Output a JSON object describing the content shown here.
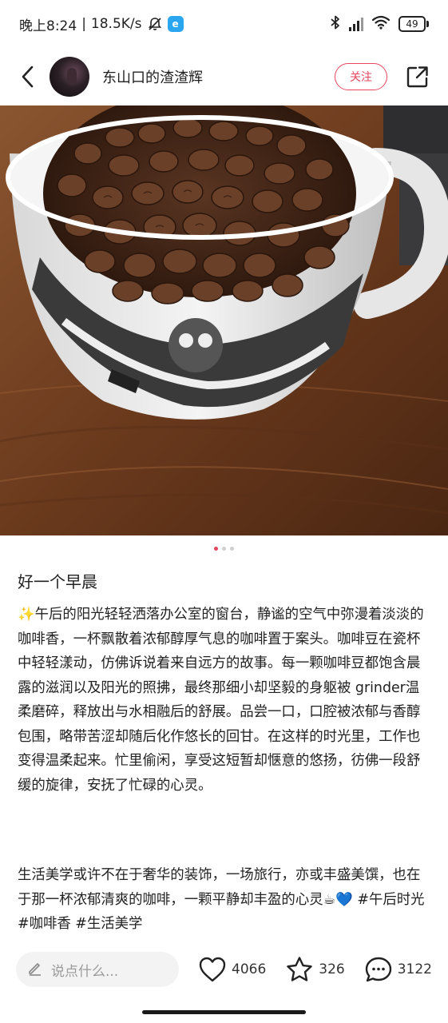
{
  "status_bar": {
    "time": "晚上8:24",
    "separator": "|",
    "network_speed": "18.5K/s",
    "battery": "49",
    "app_badge": "e"
  },
  "header": {
    "username": "东山口的渣渣辉",
    "follow_label": "关注"
  },
  "carousel": {
    "total": 3,
    "active_index": 0
  },
  "post": {
    "title": "好一个早晨",
    "paragraph_1": "✨午后的阳光轻轻洒落办公室的窗台，静谧的空气中弥漫着淡淡的咖啡香，一杯飘散着浓郁醇厚气息的咖啡置于案头。咖啡豆在瓷杯中轻轻漾动，仿佛诉说着来自远方的故事。每一颗咖啡豆都饱含晨露的滋润以及阳光的照拂，最终那细小却坚毅的身躯被 grinder温柔磨碎，释放出与水相融后的舒展。品尝一口，口腔被浓郁与香醇包围，略带苦涩却随后化作悠长的回甘。在这样的时光里，工作也变得温柔起来。忙里偷闲，享受这短暂却惬意的悠扬，彷佛一段舒缓的旋律，安抚了忙碌的心灵。",
    "paragraph_2": "生活美学或许不在于奢华的装饰，一场旅行，亦或丰盛美馔，也在于那一杯浓郁清爽的咖啡，一颗平静却丰盈的心灵☕💙 #午后时光 #咖啡香 #生活美学"
  },
  "bottom_bar": {
    "comment_placeholder": "说点什么...",
    "likes": "4066",
    "favorites": "326",
    "comments": "3122"
  },
  "colors": {
    "accent": "#e8465f",
    "text": "#222222",
    "placeholder": "#9a9a9a",
    "input_bg": "#f3f3f3"
  },
  "icons": [
    "back-chevron-icon",
    "share-icon",
    "pen-icon",
    "heart-icon",
    "star-icon",
    "comment-bubble-icon",
    "bluetooth-icon",
    "signal-icon",
    "wifi-icon",
    "battery-icon",
    "bell-mute-icon"
  ]
}
